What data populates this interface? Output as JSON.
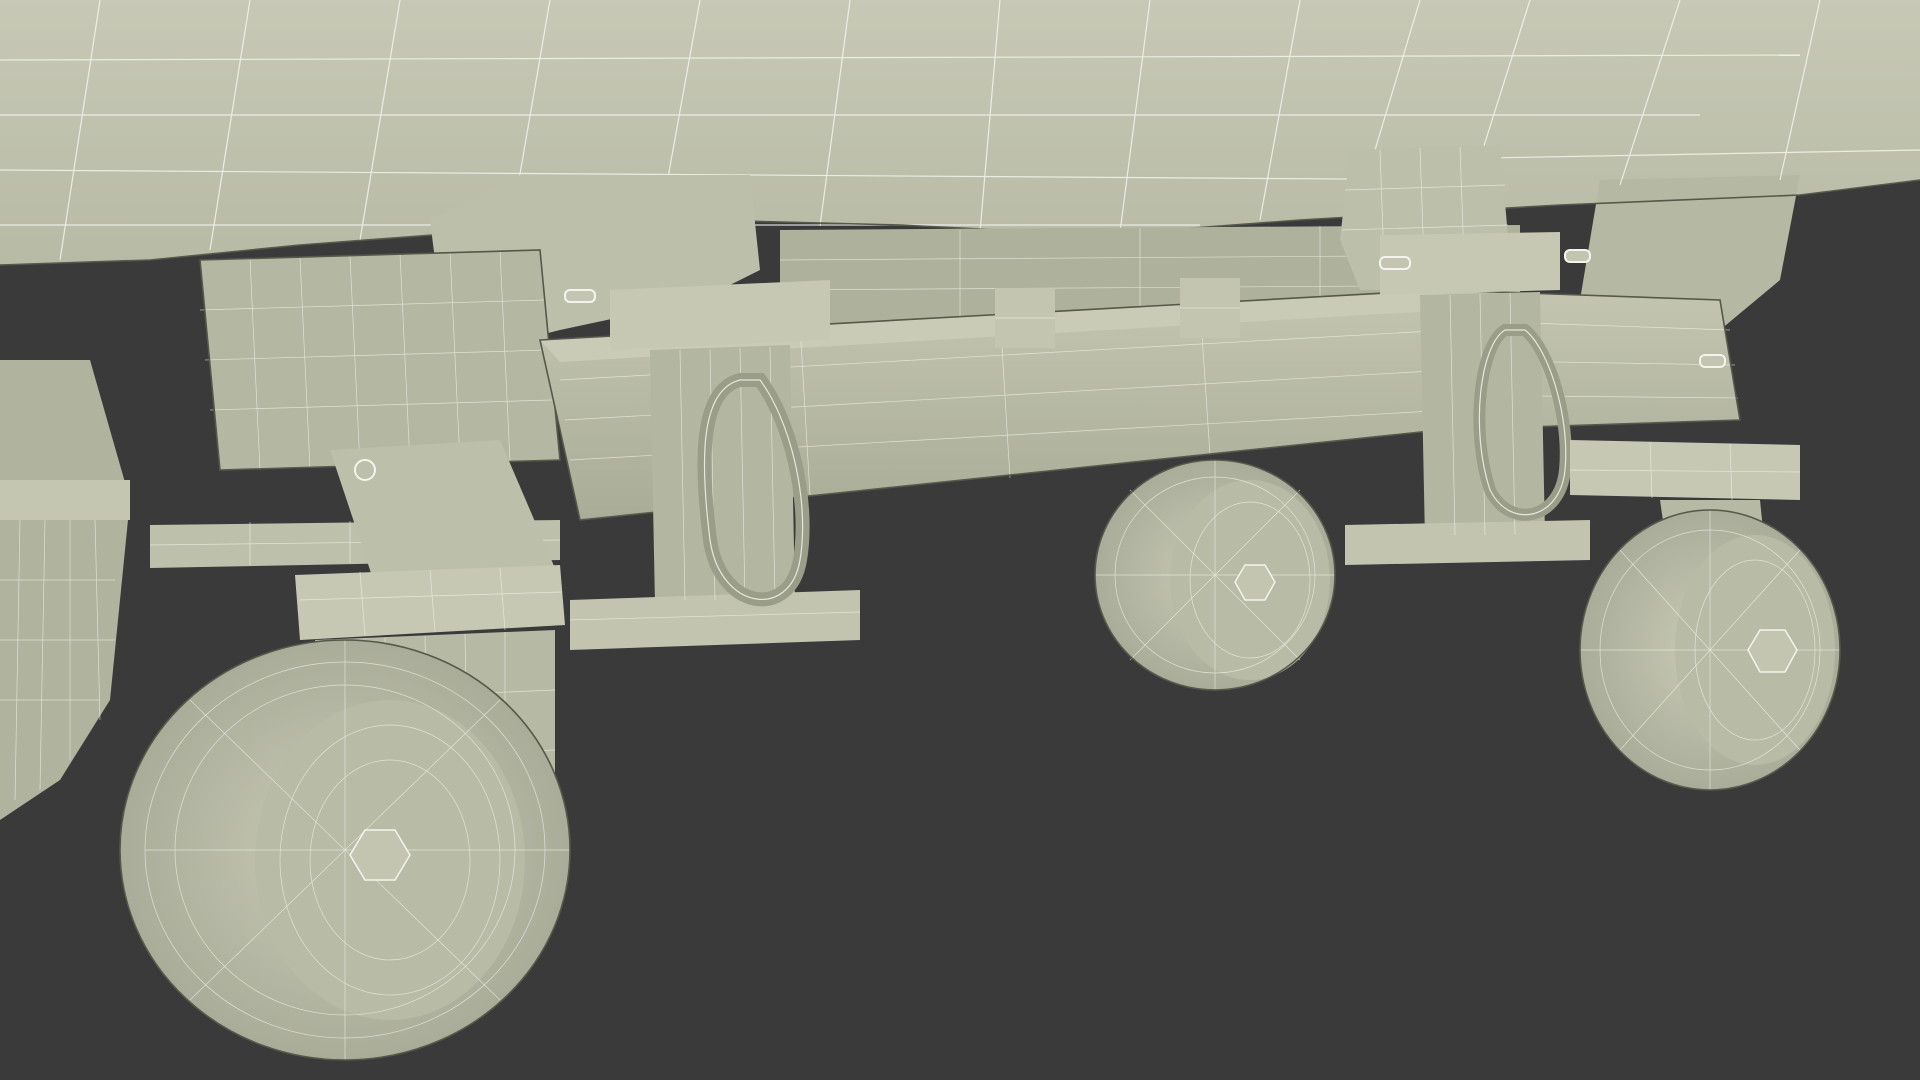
{
  "scene": {
    "subject": "wireframe-3d-render",
    "colors": {
      "background": "#3a3a3a",
      "surface_light": "#c9cbb8",
      "surface_mid": "#b3b6a1",
      "surface_dark": "#9a9d88",
      "wire": "#f4f4ee"
    }
  }
}
